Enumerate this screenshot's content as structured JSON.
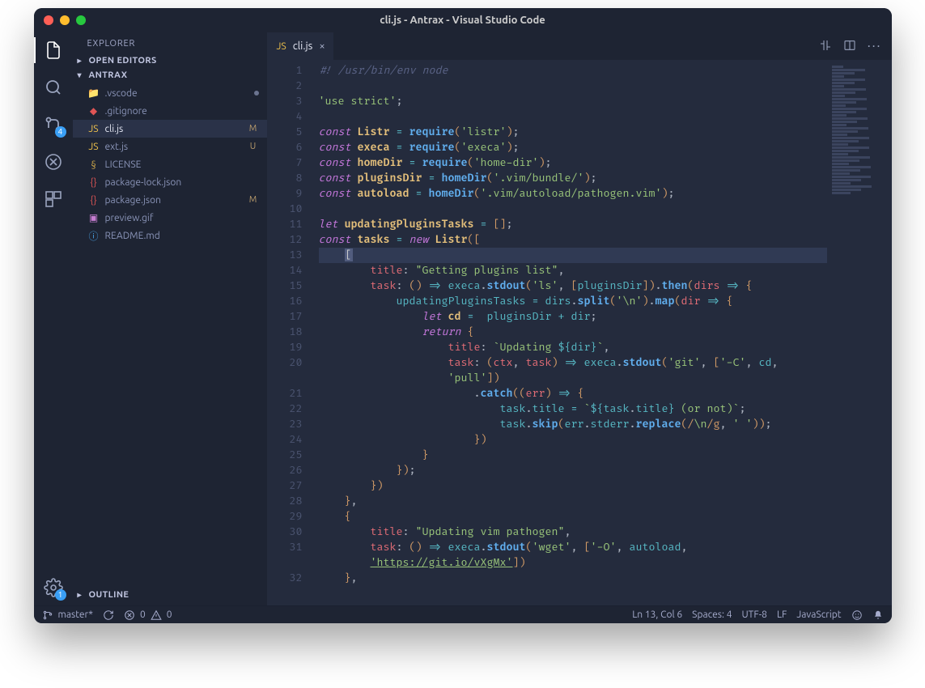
{
  "window": {
    "title": "cli.js - Antrax - Visual Studio Code"
  },
  "sidebar": {
    "heading": "EXPLORER",
    "sections": {
      "open_editors": "OPEN EDITORS",
      "project": "ANTRAX",
      "outline": "OUTLINE"
    },
    "files": [
      {
        "icon": "folder",
        "name": ".vscode",
        "marker": "dot"
      },
      {
        "icon": "git",
        "name": ".gitignore"
      },
      {
        "icon": "js",
        "name": "cli.js",
        "tag": "M",
        "selected": true
      },
      {
        "icon": "js",
        "name": "ext.js",
        "tag": "U"
      },
      {
        "icon": "lic",
        "name": "LICENSE"
      },
      {
        "icon": "json",
        "name": "package-lock.json"
      },
      {
        "icon": "json",
        "name": "package.json",
        "tag": "M"
      },
      {
        "icon": "img",
        "name": "preview.gif"
      },
      {
        "icon": "info",
        "name": "README.md"
      }
    ]
  },
  "activity": {
    "scm_badge": "4",
    "gear_badge": "1"
  },
  "tabs": {
    "active": {
      "label": "cli.js"
    }
  },
  "status": {
    "branch": "master*",
    "errors": "0",
    "warnings": "0",
    "cursor": "Ln 13, Col 6",
    "spaces": "Spaces: 4",
    "encoding": "UTF-8",
    "eol": "LF",
    "language": "JavaScript"
  },
  "code": {
    "lines_total": 32,
    "highlight_line": 13,
    "content": [
      "#! /usr/bin/env node",
      "",
      "'use strict';",
      "",
      "const Listr = require('listr');",
      "const execa = require('execa');",
      "const homeDir = require('home-dir');",
      "const pluginsDir = homeDir('.vim/bundle/');",
      "const autoload = homeDir('.vim/autoload/pathogen.vim');",
      "",
      "let updatingPluginsTasks = [];",
      "const tasks = new Listr([",
      "    [",
      "        title: \"Getting plugins list\",",
      "        task: () => execa.stdout('ls', [pluginsDir]).then(dirs => {",
      "            updatingPluginsTasks = dirs.split('\\n').map(dir => {",
      "                let cd =  pluginsDir + dir;",
      "                return {",
      "                    title: `Updating ${dir}`,",
      "                    task: (ctx, task) => execa.stdout('git', ['-C', cd,",
      "                    'pull'])",
      "                        .catch((err) => {",
      "                            task.title = `${task.title} (or not)`;",
      "                            task.skip(err.stderr.replace(/\\n/g, ' '));",
      "                        })",
      "                }",
      "            });",
      "        })",
      "    },",
      "    {",
      "        title: \"Updating vim pathogen\",",
      "        task: () => execa.stdout('wget', ['-O', autoload,",
      "        'https://git.io/vXgMx'])",
      "    },"
    ]
  }
}
